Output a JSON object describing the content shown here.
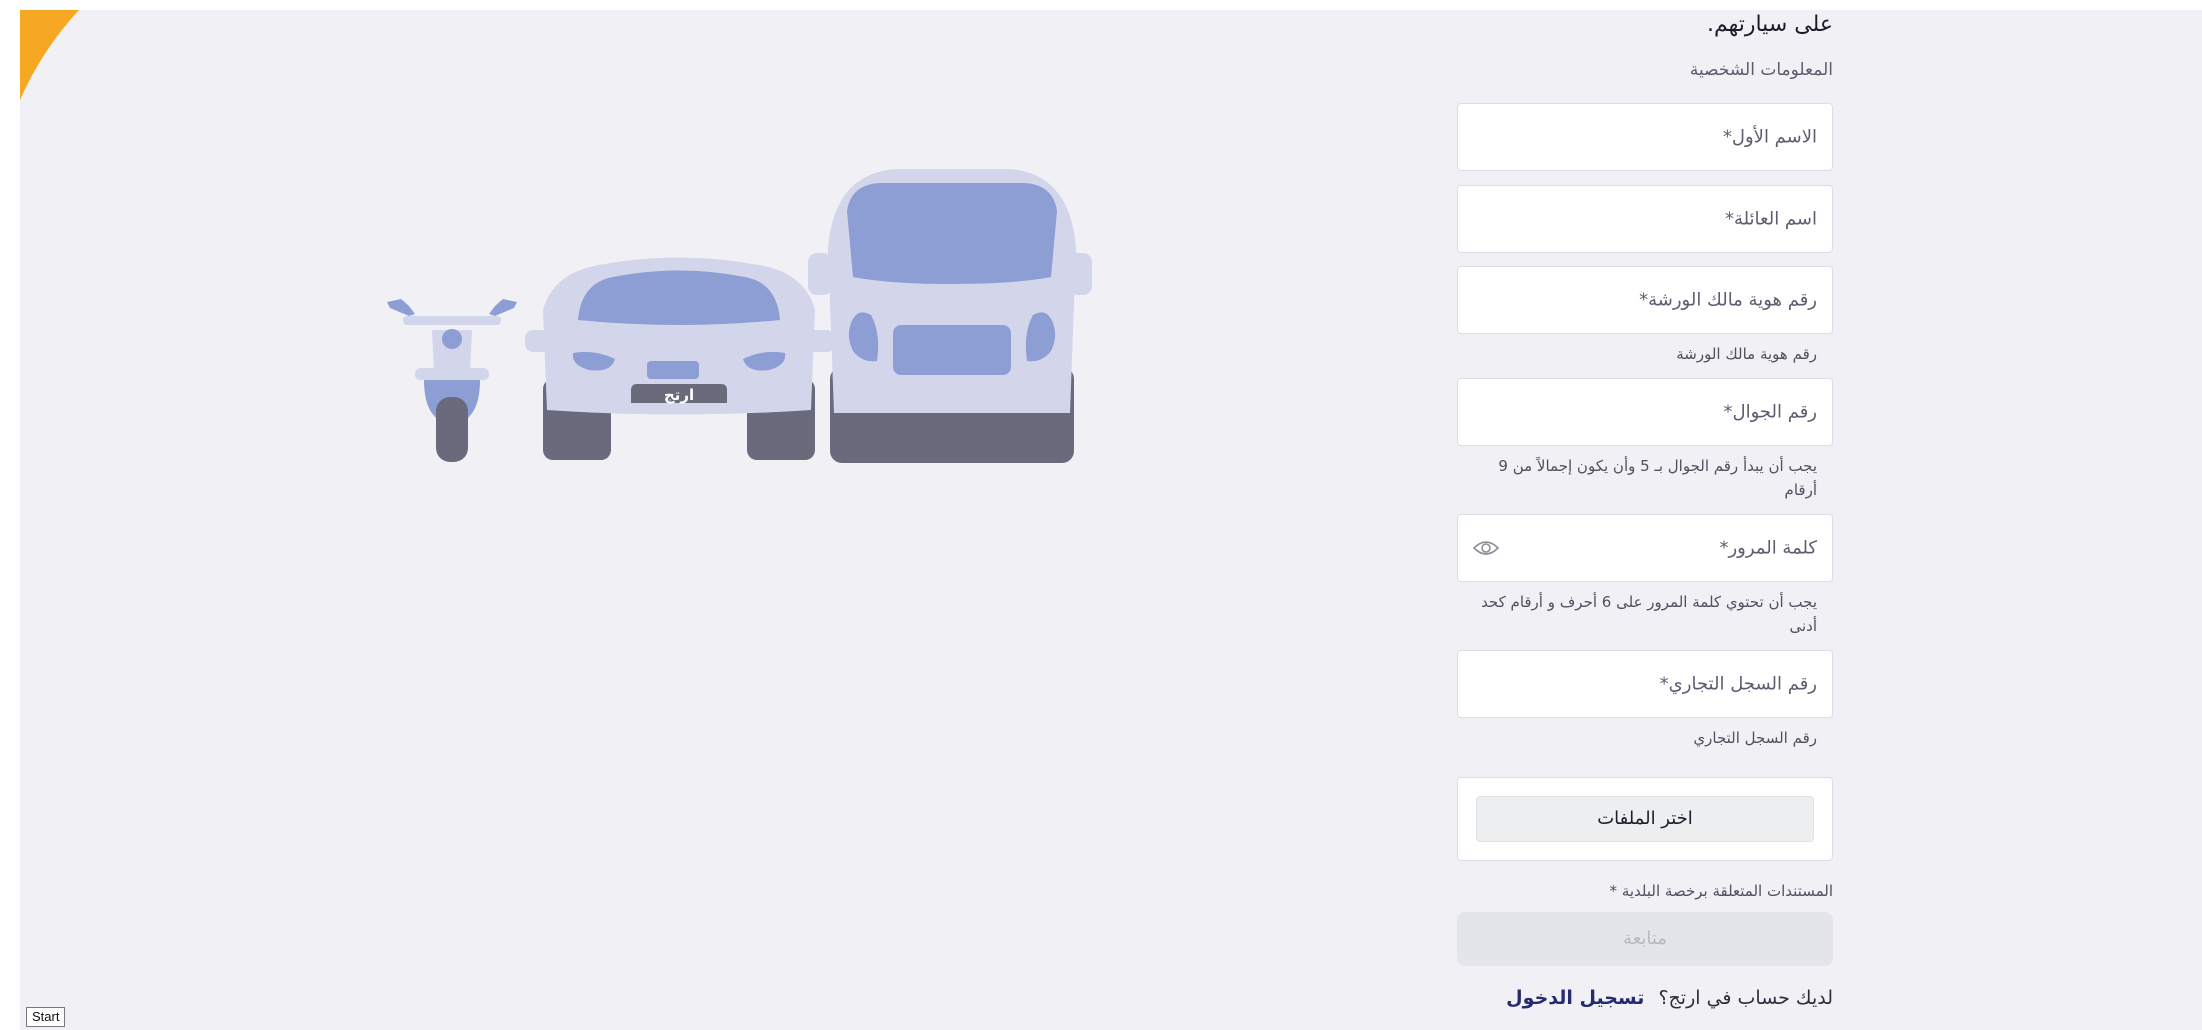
{
  "colors": {
    "accent": "#f7a823",
    "link": "#262a73",
    "vehicle_light": "#d3d5ea",
    "vehicle_body": "#8d9ed4",
    "vehicle_tire": "#6a6a7d"
  },
  "form": {
    "heading": "على سيارتهم.",
    "section_title": "المعلومات الشخصية",
    "first_name_placeholder": "الاسم الأول*",
    "last_name_placeholder": "اسم العائلة*",
    "owner_id_placeholder": "رقم هوية مالك الورشة*",
    "owner_id_hint": "رقم هوية مالك الورشة",
    "mobile_placeholder": "رقم الجوال*",
    "mobile_hint": "يجب أن يبدأ رقم الجوال بـ 5 وأن يكون إجمالاً من 9 أرقام",
    "password_placeholder": "كلمة المرور*",
    "password_hint": "يجب أن تحتوي كلمة المرور على 6 أحرف و أرقام كحد أدنى",
    "cr_placeholder": "رقم السجل التجاري*",
    "cr_hint": "رقم السجل التجاري",
    "choose_files_label": "اختر الملفات",
    "documents_label": "المستندات المتعلقة برخصة البلدية *",
    "continue_label": "متابعة",
    "have_account_text": "لديك حساب في ارتج؟",
    "login_label": "تسجيل الدخول"
  },
  "illustration": {
    "plate_text": "ارتج"
  },
  "taskbar": {
    "start_label": "Start"
  }
}
